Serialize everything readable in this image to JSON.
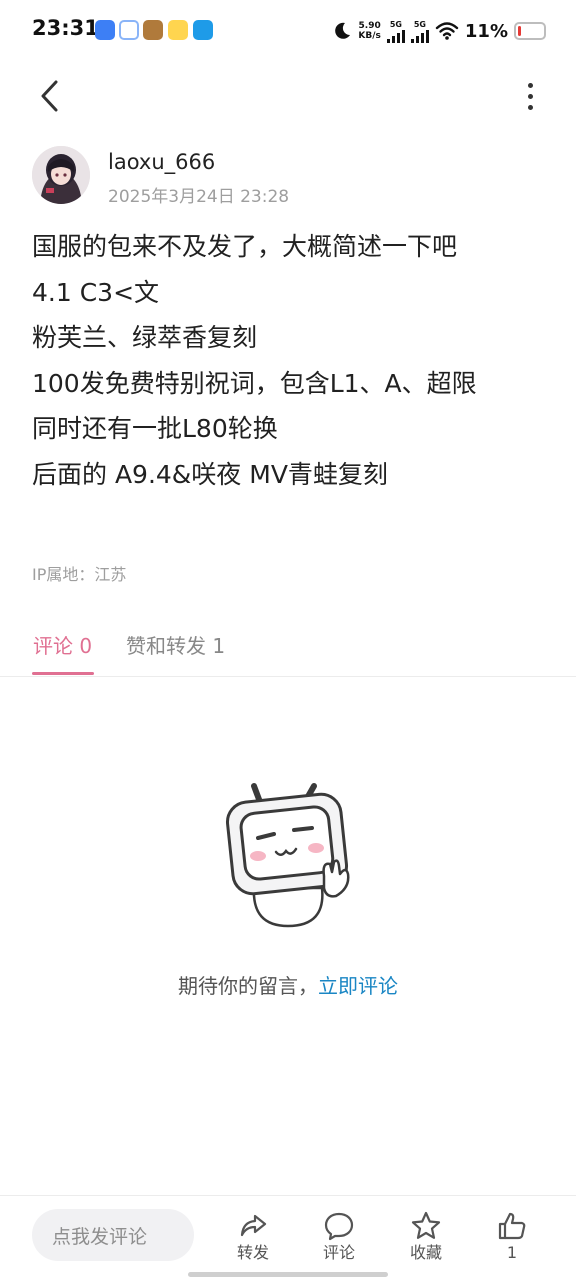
{
  "status_bar": {
    "time": "23:31",
    "net_speed_value": "5.90",
    "net_speed_unit": "KB/s",
    "signal1_label": "5G",
    "signal2_label": "5G",
    "battery_percent": "11%",
    "battery_level": 0.11,
    "battery_color": "#e53935"
  },
  "header": {
    "back_icon": "chevron-left-icon",
    "more_icon": "more-vertical-icon"
  },
  "post": {
    "author": "laoxu_666",
    "time": "2025年3月24日 23:28",
    "lines": [
      "国服的包来不及发了，大概简述一下吧",
      "4.1 C3<文",
      "粉芙兰、绿萃香复刻",
      "100发免费特别祝词，包含L1、A、超限",
      "同时还有一批L80轮换",
      "后面的 A9.4&咲夜 MV青蛙复刻"
    ],
    "ip": "IP属地：江苏"
  },
  "tabs": [
    {
      "label": "评论 0",
      "active": true
    },
    {
      "label": "赞和转发 1",
      "active": false
    }
  ],
  "empty_state": {
    "prefix": "期待你的留言，",
    "link": "立即评论"
  },
  "bottom_bar": {
    "input_placeholder": "点我发评论",
    "actions": [
      {
        "icon": "share-icon",
        "label": "转发"
      },
      {
        "icon": "comment-icon",
        "label": "评论"
      },
      {
        "icon": "star-icon",
        "label": "收藏"
      },
      {
        "icon": "thumbs-up-icon",
        "label": "1"
      }
    ]
  },
  "colors": {
    "accent": "#e07092",
    "link": "#1a86c4"
  }
}
